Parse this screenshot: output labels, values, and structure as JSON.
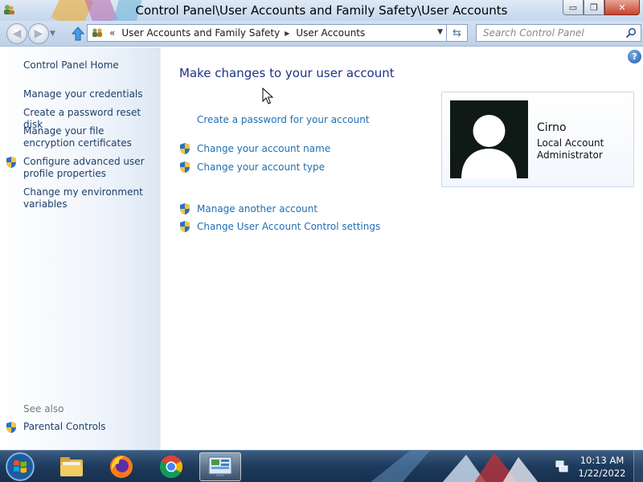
{
  "window": {
    "title": "Control Panel\\User Accounts and Family Safety\\User Accounts",
    "min_glyph": "▭",
    "max_glyph": "❐",
    "close_glyph": "✕"
  },
  "navbar": {
    "back_glyph": "◀",
    "forward_glyph": "▶",
    "drop_glyph": "▼",
    "up_glyph": "⇧",
    "address_overflow": "«",
    "breadcrumb_1": "User Accounts and Family Safety",
    "breadcrumb_sep": "▶",
    "breadcrumb_2": "User Accounts",
    "address_drop": "▼",
    "refresh_glyph": "⇆",
    "search_placeholder": "Search Control Panel"
  },
  "sidebar": {
    "home": "Control Panel Home",
    "tasks": [
      "Manage your credentials",
      "Create a password reset disk",
      "Manage your file encryption certificates",
      "Configure advanced user profile properties",
      "Change my environment variables"
    ],
    "see_also_label": "See also",
    "see_also": [
      "Parental Controls"
    ]
  },
  "main": {
    "help_glyph": "?",
    "title": "Make changes to your user account",
    "links": [
      "Create a password for your account",
      "Change your account name",
      "Change your account type",
      "Manage another account",
      "Change User Account Control settings"
    ]
  },
  "account": {
    "name": "Cirno",
    "type": "Local Account",
    "role": "Administrator"
  },
  "taskbar": {
    "clock_time": "10:13 AM",
    "clock_date": "1/22/2022"
  }
}
